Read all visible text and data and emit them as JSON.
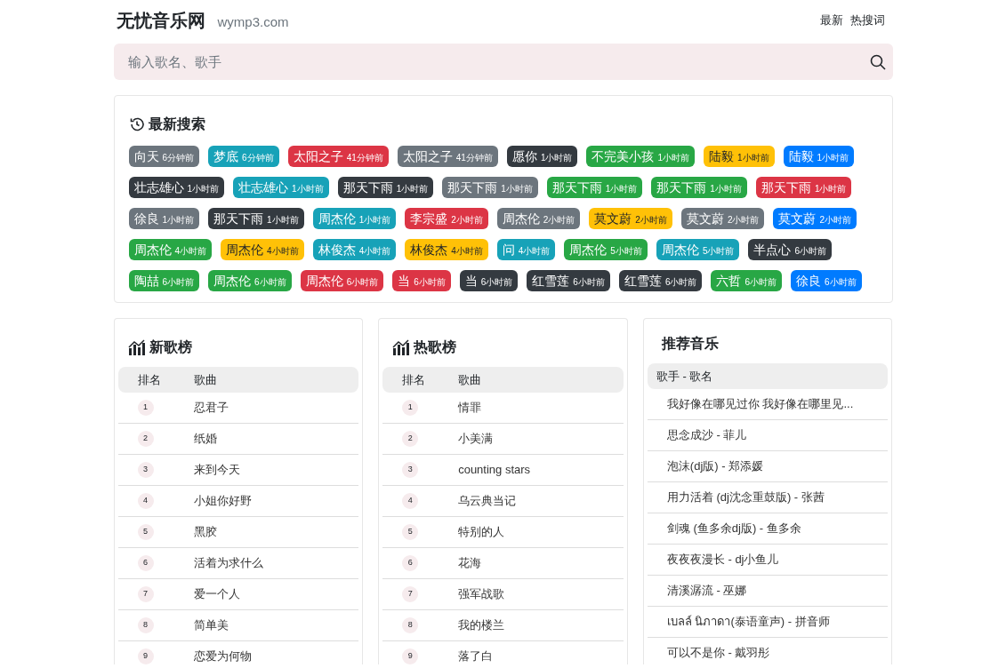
{
  "header": {
    "site_name": "无忧音乐网",
    "domain": "wymp3.com",
    "nav": [
      "最新",
      "热搜词"
    ]
  },
  "search": {
    "placeholder": "输入歌名、歌手"
  },
  "recent_searches": {
    "title": "最新搜索",
    "tags": [
      {
        "name": "向天",
        "time": "6分钟前",
        "color": "#6c757d"
      },
      {
        "name": "梦底",
        "time": "6分钟前",
        "color": "#17a2b8"
      },
      {
        "name": "太阳之子",
        "time": "41分钟前",
        "color": "#dc3545"
      },
      {
        "name": "太阳之子",
        "time": "41分钟前",
        "color": "#6c757d"
      },
      {
        "name": "愿你",
        "time": "1小时前",
        "color": "#343a40"
      },
      {
        "name": "不完美小孩",
        "time": "1小时前",
        "color": "#28a745"
      },
      {
        "name": "陆毅",
        "time": "1小时前",
        "color": "#ffc107"
      },
      {
        "name": "陆毅",
        "time": "1小时前",
        "color": "#007bff"
      },
      {
        "name": "壮志雄心",
        "time": "1小时前",
        "color": "#343a40"
      },
      {
        "name": "壮志雄心",
        "time": "1小时前",
        "color": "#17a2b8"
      },
      {
        "name": "那天下雨",
        "time": "1小时前",
        "color": "#343a40"
      },
      {
        "name": "那天下雨",
        "time": "1小时前",
        "color": "#6c757d"
      },
      {
        "name": "那天下雨",
        "time": "1小时前",
        "color": "#28a745"
      },
      {
        "name": "那天下雨",
        "time": "1小时前",
        "color": "#28a745"
      },
      {
        "name": "那天下雨",
        "time": "1小时前",
        "color": "#dc3545"
      },
      {
        "name": "徐良",
        "time": "1小时前",
        "color": "#6c757d"
      },
      {
        "name": "那天下雨",
        "time": "1小时前",
        "color": "#343a40"
      },
      {
        "name": "周杰伦",
        "time": "1小时前",
        "color": "#17a2b8"
      },
      {
        "name": "李宗盛",
        "time": "2小时前",
        "color": "#dc3545"
      },
      {
        "name": "周杰伦",
        "time": "2小时前",
        "color": "#6c757d"
      },
      {
        "name": "莫文蔚",
        "time": "2小时前",
        "color": "#ffc107"
      },
      {
        "name": "莫文蔚",
        "time": "2小时前",
        "color": "#6c757d"
      },
      {
        "name": "莫文蔚",
        "time": "2小时前",
        "color": "#007bff"
      },
      {
        "name": "周杰伦",
        "time": "4小时前",
        "color": "#28a745"
      },
      {
        "name": "周杰伦",
        "time": "4小时前",
        "color": "#ffc107"
      },
      {
        "name": "林俊杰",
        "time": "4小时前",
        "color": "#17a2b8"
      },
      {
        "name": "林俊杰",
        "time": "4小时前",
        "color": "#ffc107"
      },
      {
        "name": "问",
        "time": "4小时前",
        "color": "#17a2b8"
      },
      {
        "name": "周杰伦",
        "time": "5小时前",
        "color": "#28a745"
      },
      {
        "name": "周杰伦",
        "time": "5小时前",
        "color": "#17a2b8"
      },
      {
        "name": "半点心",
        "time": "6小时前",
        "color": "#343a40"
      },
      {
        "name": "陶喆",
        "time": "6小时前",
        "color": "#28a745"
      },
      {
        "name": "周杰伦",
        "time": "6小时前",
        "color": "#28a745"
      },
      {
        "name": "周杰伦",
        "time": "6小时前",
        "color": "#dc3545"
      },
      {
        "name": "当",
        "time": "6小时前",
        "color": "#dc3545"
      },
      {
        "name": "当",
        "time": "6小时前",
        "color": "#343a40"
      },
      {
        "name": "红雪莲",
        "time": "6小时前",
        "color": "#343a40"
      },
      {
        "name": "红雪莲",
        "time": "6小时前",
        "color": "#343a40"
      },
      {
        "name": "六哲",
        "time": "6小时前",
        "color": "#28a745"
      },
      {
        "name": "徐良",
        "time": "6小时前",
        "color": "#007bff"
      }
    ]
  },
  "charts": [
    {
      "title": "新歌榜",
      "columns": [
        "排名",
        "歌曲"
      ],
      "rows": [
        {
          "rank": "1",
          "song": "忍君子"
        },
        {
          "rank": "2",
          "song": "纸婚"
        },
        {
          "rank": "3",
          "song": "来到今天"
        },
        {
          "rank": "4",
          "song": "小姐你好野"
        },
        {
          "rank": "5",
          "song": "黑胶"
        },
        {
          "rank": "6",
          "song": "活着为求什么"
        },
        {
          "rank": "7",
          "song": "爱一个人"
        },
        {
          "rank": "8",
          "song": "简单美"
        },
        {
          "rank": "9",
          "song": "恋爱为何物"
        }
      ]
    },
    {
      "title": "热歌榜",
      "columns": [
        "排名",
        "歌曲"
      ],
      "rows": [
        {
          "rank": "1",
          "song": "情罪"
        },
        {
          "rank": "2",
          "song": "小美满"
        },
        {
          "rank": "3",
          "song": "counting stars"
        },
        {
          "rank": "4",
          "song": "乌云典当记"
        },
        {
          "rank": "5",
          "song": "特别的人"
        },
        {
          "rank": "6",
          "song": "花海"
        },
        {
          "rank": "7",
          "song": "强军战歌"
        },
        {
          "rank": "8",
          "song": "我的楼兰"
        },
        {
          "rank": "9",
          "song": "落了白"
        }
      ]
    }
  ],
  "recommended": {
    "title": "推荐音乐",
    "header": "歌手 - 歌名",
    "items": [
      "我好像在哪见过你 我好像在哪里见...",
      "思念成沙 - 菲儿",
      "泡沫(dj版) - 郑添媛",
      "用力活着 (dj沈念重鼓版) - 张茜",
      "剑魂 (鱼多余dj版) - 鱼多余",
      "夜夜夜漫长 - dj小鱼儿",
      "清溪潺流 - 巫娜",
      "เบลล์ นิภาดา(泰语童声) - 拼音师",
      "可以不是你 - 戴羽彤"
    ]
  }
}
